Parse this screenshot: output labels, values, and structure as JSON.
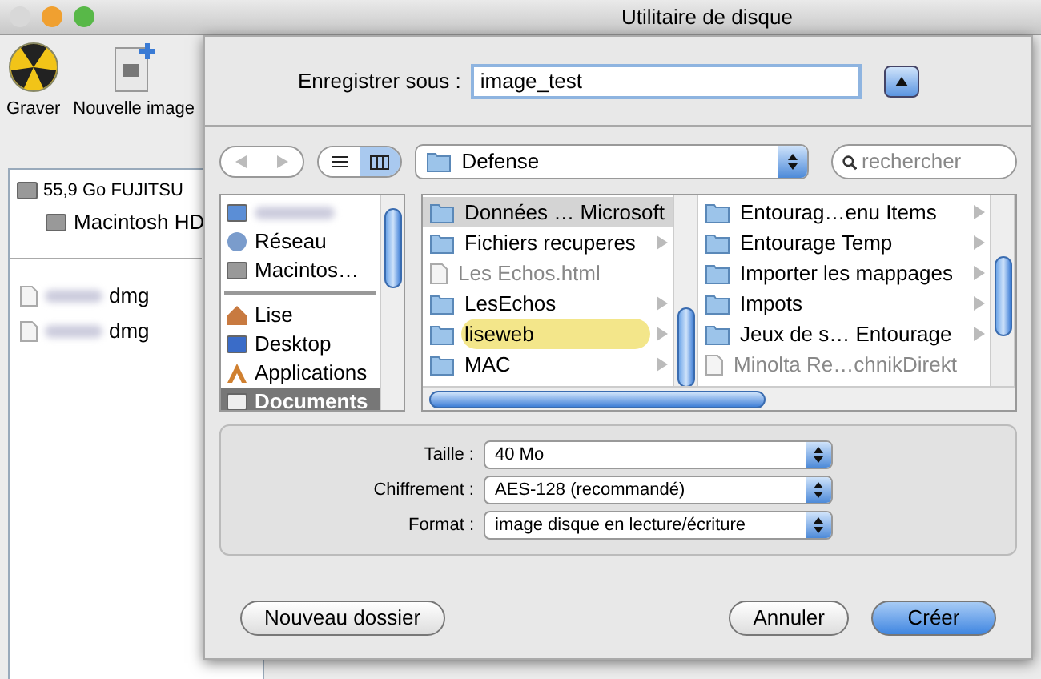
{
  "window": {
    "title": "Utilitaire de disque",
    "controls": [
      {
        "color": "#d8d8d8"
      },
      {
        "color": "#f0a030"
      },
      {
        "color": "#58b848"
      }
    ]
  },
  "toolbar": [
    {
      "label": "Graver",
      "kind": "burn"
    },
    {
      "label": "Nouvelle image",
      "kind": "image"
    }
  ],
  "disks": [
    {
      "label": "55,9 Go FUJITSU",
      "children": [
        {
          "label": "Macintosh HD"
        }
      ]
    }
  ],
  "images": [
    {
      "label": "dmg"
    },
    {
      "label": "dmg"
    }
  ],
  "sheet": {
    "save_as": {
      "label": "Enregistrer sous :",
      "value": "image_test"
    },
    "view_modes": [
      {
        "kind": "list",
        "selected": false
      },
      {
        "kind": "columns",
        "selected": true
      }
    ],
    "location": "Defense",
    "search": {
      "placeholder": "rechercher"
    },
    "sidebar": [
      {
        "kind": "computer",
        "selected": false
      },
      {
        "label": "Réseau",
        "kind": "network",
        "selected": false
      },
      {
        "label": "Macintos…",
        "kind": "disk",
        "selected": false
      },
      {
        "kind": "divider"
      },
      {
        "label": "Lise",
        "kind": "home",
        "selected": false
      },
      {
        "label": "Desktop",
        "kind": "desktop",
        "selected": false
      },
      {
        "label": "Applications",
        "kind": "apps",
        "selected": false
      },
      {
        "label": "Documents",
        "kind": "docs",
        "selected": true
      }
    ],
    "columns": [
      [
        {
          "label": "Données … Microsoft",
          "kind": "folder",
          "selected": true
        },
        {
          "label": "Fichiers recuperes",
          "kind": "folder",
          "selected": false
        },
        {
          "label": "Les Echos.html",
          "kind": "file",
          "selected": false
        },
        {
          "label": "LesEchos",
          "kind": "folder",
          "selected": false
        },
        {
          "label": "liseweb",
          "kind": "folder",
          "selected": false,
          "color": "#f3e68a"
        },
        {
          "label": "MAC",
          "kind": "folder",
          "selected": false
        }
      ],
      [
        {
          "label": "Entourag…enu Items",
          "kind": "folder",
          "selected": false
        },
        {
          "label": "Entourage Temp",
          "kind": "folder",
          "selected": false
        },
        {
          "label": "Importer les mappages",
          "kind": "folder",
          "selected": false
        },
        {
          "label": "Impots",
          "kind": "folder",
          "selected": false
        },
        {
          "label": "Jeux de s… Entourage",
          "kind": "folder",
          "selected": false
        },
        {
          "label": "Minolta Re…chnikDirekt",
          "kind": "file",
          "selected": false
        }
      ]
    ],
    "options": [
      {
        "label": "Taille :",
        "value": "40 Mo"
      },
      {
        "label": "Chiffrement :",
        "value": "AES-128 (recommandé)"
      },
      {
        "label": "Format :",
        "value": "image disque en lecture/écriture"
      }
    ],
    "buttons": [
      {
        "label": "Nouveau dossier",
        "kind": "plain"
      },
      {
        "label": "Annuler",
        "kind": "plain"
      },
      {
        "label": "Créer",
        "kind": "default"
      }
    ]
  }
}
